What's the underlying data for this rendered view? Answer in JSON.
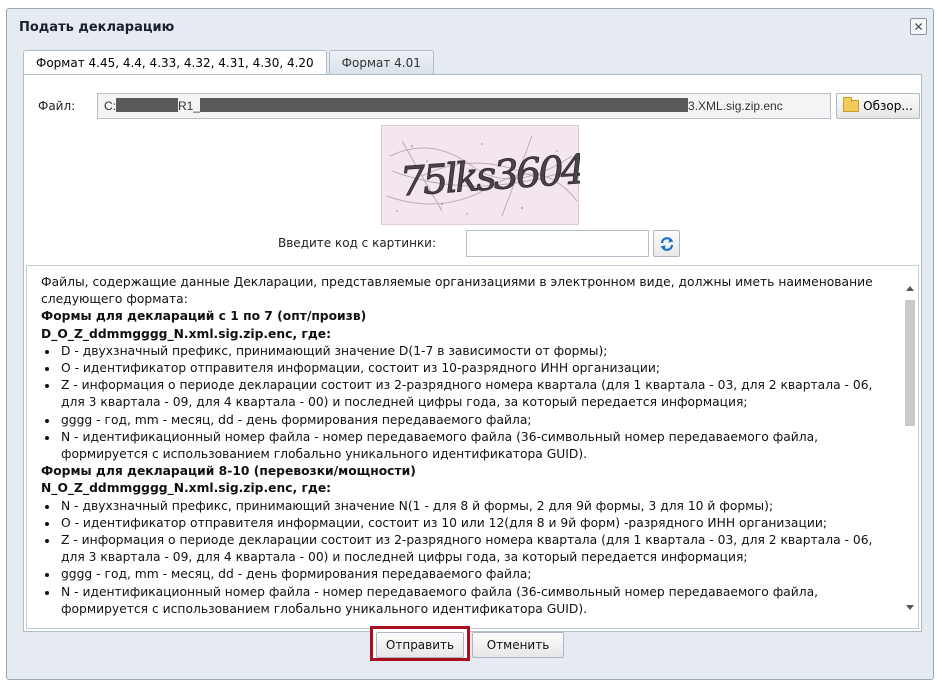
{
  "dialog": {
    "title": "Подать декларацию",
    "close_label": "✕"
  },
  "tabs": [
    {
      "label": "Формат 4.45, 4.4, 4.33, 4.32, 4.31, 4.30, 4.20",
      "active": true
    },
    {
      "label": "Формат 4.01",
      "active": false
    }
  ],
  "file": {
    "label": "Файл:",
    "value_prefix": "C:",
    "value_mid": "R1_",
    "value_suffix": "3.XML.sig.zip.enc",
    "browse_label": "Обзор..."
  },
  "captcha": {
    "code_text": "75lks3604",
    "prompt_label": "Введите код с картинки:",
    "input_value": ""
  },
  "info": {
    "intro": "Файлы, содержащие данные Декларации, представляемые организациями в электронном виде, должны иметь наименование следующего формата:",
    "section1_title": "Формы для деклараций с 1 по 7 (опт/произв)",
    "section1_pattern": "D_O_Z_ddmmgggg_N.xml.sig.zip.enc, где:",
    "section1_items": [
      "D - двухзначный префикс, принимающий значение D(1-7 в зависимости от формы);",
      "O - идентификатор отправителя информации, состоит из 10-разрядного ИНН организации;",
      "Z - информация о периоде декларации состоит из 2-разрядного номера квартала (для 1 квартала - 03, для 2 квартала - 06, для 3 квартала - 09, для 4 квартала - 00) и последней цифры года, за который передается информация;",
      "gggg - год, mm - месяц, dd - день формирования передаваемого файла;",
      "N - идентификационный номер файла - номер передаваемого файла (36-символьный номер передаваемого файла, формируется с использованием глобально уникального идентификатора GUID)."
    ],
    "section2_title": "Формы для деклараций 8-10 (перевозки/мощности)",
    "section2_pattern": "N_O_Z_ddmmgggg_N.xml.sig.zip.enc, где:",
    "section2_items": [
      "N - двухзначный префикс, принимающий значение N(1 - для 8 й формы, 2 для 9й формы, 3 для 10 й формы);",
      "O - идентификатор отправителя информации, состоит из 10 или 12(для 8 и 9й форм) -разрядного ИНН организации;",
      "Z - информация о периоде декларации состоит из 2-разрядного номера квартала (для 1 квартала - 03, для 2 квартала - 06, для 3 квартала - 09, для 4 квартала - 00) и последней цифры года, за который передается информация;",
      "gggg - год, mm - месяц, dd - день формирования передаваемого файла;",
      "N - идентификационный номер файла - номер передаваемого файла (36-символьный номер передаваемого файла, формируется с использованием глобально уникального идентификатора GUID)."
    ]
  },
  "footer": {
    "submit_label": "Отправить",
    "cancel_label": "Отменить"
  },
  "colors": {
    "highlight": "#a8101f",
    "dialog_bg": "#e6ebf1",
    "captcha_bg": "#f4e6ef",
    "refresh_blue": "#1a6fc9"
  }
}
